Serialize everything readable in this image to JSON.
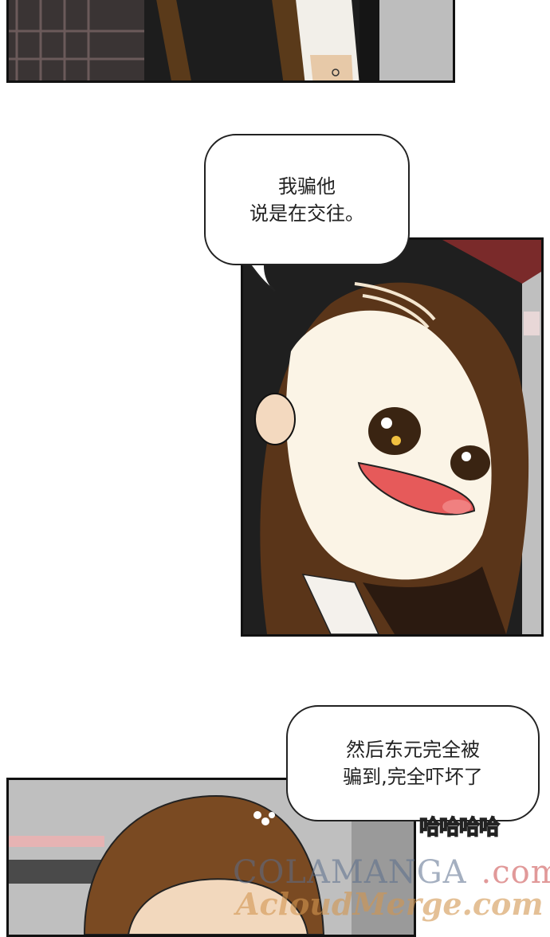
{
  "panels": {
    "top": {
      "description": ""
    },
    "middle": {
      "description": ""
    },
    "bottom": {
      "description": ""
    }
  },
  "bubble1": {
    "line1": "我骗他",
    "line2": "说是在交往。"
  },
  "bubble2": {
    "line1": "然后东元完全被",
    "line2": "骗到,完全吓坏了"
  },
  "sfx": {
    "text": "哈哈哈哈"
  },
  "watermark": {
    "line1_main": "COLAMANGA",
    "line1_suffix": ".com",
    "line2": "AcloudMerge.com"
  }
}
